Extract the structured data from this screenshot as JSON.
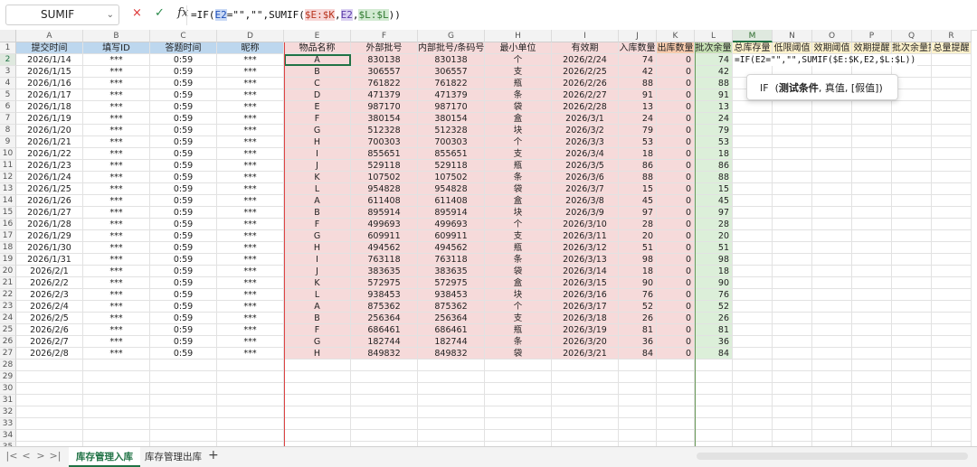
{
  "formula_bar": {
    "name_box": "SUMIF",
    "cancel_icon": "×",
    "confirm_icon": "✓",
    "fx_label": "fx",
    "formula_parts": [
      "=IF(",
      "E2",
      "=\"\",\"\",SUMIF(",
      "$E:$K",
      ",",
      "E2",
      ",",
      "$L:$L",
      "))"
    ]
  },
  "columns": [
    {
      "letter": "A",
      "header": "提交时间"
    },
    {
      "letter": "B",
      "header": "填写ID"
    },
    {
      "letter": "C",
      "header": "答题时间"
    },
    {
      "letter": "D",
      "header": "昵称"
    },
    {
      "letter": "E",
      "header": "物品名称"
    },
    {
      "letter": "F",
      "header": "外部批号"
    },
    {
      "letter": "G",
      "header": "内部批号/条码号"
    },
    {
      "letter": "H",
      "header": "最小单位"
    },
    {
      "letter": "I",
      "header": "有效期"
    },
    {
      "letter": "J",
      "header": "入库数量"
    },
    {
      "letter": "K",
      "header": "出库数量"
    },
    {
      "letter": "L",
      "header": "批次余量"
    },
    {
      "letter": "M",
      "header": "总库存量"
    },
    {
      "letter": "N",
      "header": "低限阈值"
    },
    {
      "letter": "O",
      "header": "效期阈值"
    },
    {
      "letter": "P",
      "header": "效期提醒"
    },
    {
      "letter": "Q",
      "header": "批次余量提醒"
    },
    {
      "letter": "R",
      "header": "总量提醒"
    }
  ],
  "rows": [
    [
      "2026/1/14",
      "***",
      "0:59",
      "***",
      "A",
      "830138",
      "830138",
      "个",
      "2026/2/24",
      "74",
      "0",
      "74"
    ],
    [
      "2026/1/15",
      "***",
      "0:59",
      "***",
      "B",
      "306557",
      "306557",
      "支",
      "2026/2/25",
      "42",
      "0",
      "42"
    ],
    [
      "2026/1/16",
      "***",
      "0:59",
      "***",
      "C",
      "761822",
      "761822",
      "瓶",
      "2026/2/26",
      "88",
      "0",
      "88"
    ],
    [
      "2026/1/17",
      "***",
      "0:59",
      "***",
      "D",
      "471379",
      "471379",
      "条",
      "2026/2/27",
      "91",
      "0",
      "91"
    ],
    [
      "2026/1/18",
      "***",
      "0:59",
      "***",
      "E",
      "987170",
      "987170",
      "袋",
      "2026/2/28",
      "13",
      "0",
      "13"
    ],
    [
      "2026/1/19",
      "***",
      "0:59",
      "***",
      "F",
      "380154",
      "380154",
      "盒",
      "2026/3/1",
      "24",
      "0",
      "24"
    ],
    [
      "2026/1/20",
      "***",
      "0:59",
      "***",
      "G",
      "512328",
      "512328",
      "块",
      "2026/3/2",
      "79",
      "0",
      "79"
    ],
    [
      "2026/1/21",
      "***",
      "0:59",
      "***",
      "H",
      "700303",
      "700303",
      "个",
      "2026/3/3",
      "53",
      "0",
      "53"
    ],
    [
      "2026/1/22",
      "***",
      "0:59",
      "***",
      "I",
      "855651",
      "855651",
      "支",
      "2026/3/4",
      "18",
      "0",
      "18"
    ],
    [
      "2026/1/23",
      "***",
      "0:59",
      "***",
      "J",
      "529118",
      "529118",
      "瓶",
      "2026/3/5",
      "86",
      "0",
      "86"
    ],
    [
      "2026/1/24",
      "***",
      "0:59",
      "***",
      "K",
      "107502",
      "107502",
      "条",
      "2026/3/6",
      "88",
      "0",
      "88"
    ],
    [
      "2026/1/25",
      "***",
      "0:59",
      "***",
      "L",
      "954828",
      "954828",
      "袋",
      "2026/3/7",
      "15",
      "0",
      "15"
    ],
    [
      "2026/1/26",
      "***",
      "0:59",
      "***",
      "A",
      "611408",
      "611408",
      "盒",
      "2026/3/8",
      "45",
      "0",
      "45"
    ],
    [
      "2026/1/27",
      "***",
      "0:59",
      "***",
      "B",
      "895914",
      "895914",
      "块",
      "2026/3/9",
      "97",
      "0",
      "97"
    ],
    [
      "2026/1/28",
      "***",
      "0:59",
      "***",
      "F",
      "499693",
      "499693",
      "个",
      "2026/3/10",
      "28",
      "0",
      "28"
    ],
    [
      "2026/1/29",
      "***",
      "0:59",
      "***",
      "G",
      "609911",
      "609911",
      "支",
      "2026/3/11",
      "20",
      "0",
      "20"
    ],
    [
      "2026/1/30",
      "***",
      "0:59",
      "***",
      "H",
      "494562",
      "494562",
      "瓶",
      "2026/3/12",
      "51",
      "0",
      "51"
    ],
    [
      "2026/1/31",
      "***",
      "0:59",
      "***",
      "I",
      "763118",
      "763118",
      "条",
      "2026/3/13",
      "98",
      "0",
      "98"
    ],
    [
      "2026/2/1",
      "***",
      "0:59",
      "***",
      "J",
      "383635",
      "383635",
      "袋",
      "2026/3/14",
      "18",
      "0",
      "18"
    ],
    [
      "2026/2/2",
      "***",
      "0:59",
      "***",
      "K",
      "572975",
      "572975",
      "盒",
      "2026/3/15",
      "90",
      "0",
      "90"
    ],
    [
      "2026/2/3",
      "***",
      "0:59",
      "***",
      "L",
      "938453",
      "938453",
      "块",
      "2026/3/16",
      "76",
      "0",
      "76"
    ],
    [
      "2026/2/4",
      "***",
      "0:59",
      "***",
      "A",
      "875362",
      "875362",
      "个",
      "2026/3/17",
      "52",
      "0",
      "52"
    ],
    [
      "2026/2/5",
      "***",
      "0:59",
      "***",
      "B",
      "256364",
      "256364",
      "支",
      "2026/3/18",
      "26",
      "0",
      "26"
    ],
    [
      "2026/2/6",
      "***",
      "0:59",
      "***",
      "F",
      "686461",
      "686461",
      "瓶",
      "2026/3/19",
      "81",
      "0",
      "81"
    ],
    [
      "2026/2/7",
      "***",
      "0:59",
      "***",
      "G",
      "182744",
      "182744",
      "条",
      "2026/3/20",
      "36",
      "0",
      "36"
    ],
    [
      "2026/2/8",
      "***",
      "0:59",
      "***",
      "H",
      "849832",
      "849832",
      "袋",
      "2026/3/21",
      "84",
      "0",
      "84"
    ]
  ],
  "edit_cell": {
    "text": "=IF(E2=\"\",\"\",SUMIF($E:$K,E2,$L:$L))"
  },
  "tooltip": {
    "fn": "IF",
    "arg1": "测试条件",
    "rest": ", 真值, [假值])"
  },
  "sheet_tabs": [
    "库存管理入库",
    "库存管理出库"
  ],
  "active_tab": 0,
  "add_tab": "+",
  "nav_icons": [
    "|<",
    "<",
    ">",
    ">|"
  ]
}
